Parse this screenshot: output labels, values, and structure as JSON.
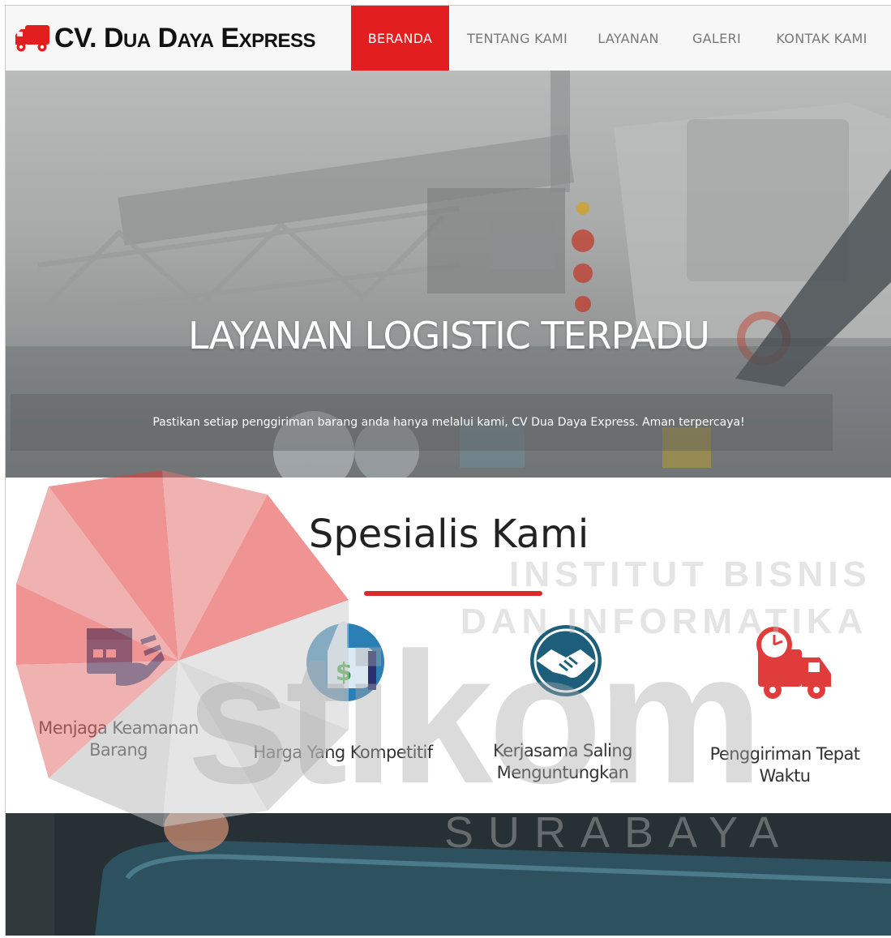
{
  "brand": {
    "name": "CV. Dua Daya Express",
    "icon": "truck-icon",
    "color": "#e31e1e"
  },
  "nav": {
    "items": [
      {
        "label": "BERANDA",
        "active": true
      },
      {
        "label": "TENTANG KAMI",
        "active": false
      },
      {
        "label": "LAYANAN",
        "active": false
      },
      {
        "label": "GALERI",
        "active": false
      },
      {
        "label": "KONTAK KAMI",
        "active": false
      }
    ],
    "active_color": "#e31e1e"
  },
  "hero": {
    "title": "LAYANAN LOGISTIC TERPADU",
    "subtitle": "Pastikan setiap penggiriman barang anda hanya melalui kami, CV Dua Daya Express. Aman terpercaya!"
  },
  "specialist": {
    "title": "Spesialis Kami",
    "accent_color": "#d92b2b",
    "features": [
      {
        "icon": "package-hand-icon",
        "label_line1": "Menjaga Keamanan",
        "label_line2": "Barang"
      },
      {
        "icon": "thumbs-up-dollar-icon",
        "label_line1": "Harga Yang Kompetitif",
        "label_line2": ""
      },
      {
        "icon": "handshake-icon",
        "label_line1": "Kerjasama Saling",
        "label_line2": "Menguntungkan"
      },
      {
        "icon": "delivery-truck-clock-icon",
        "label_line1": "Penggiriman Tepat",
        "label_line2": "Waktu"
      }
    ]
  },
  "watermark": {
    "line1": "INSTITUT BISNIS",
    "line2": "DAN INFORMATIKA",
    "logo": "stikom",
    "city": "SURABAYA",
    "logo_color": "#e31e1e"
  }
}
